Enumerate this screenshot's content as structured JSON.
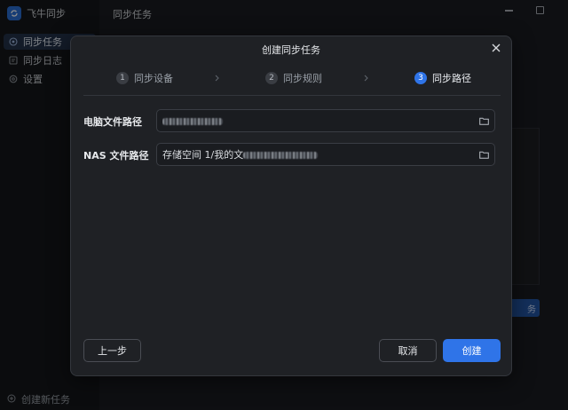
{
  "app": {
    "name": "飞牛同步",
    "main_title": "同步任务",
    "background_button_fragment": "务"
  },
  "sidebar": {
    "items": [
      {
        "label": "同步任务",
        "icon": "sync-icon",
        "active": true
      },
      {
        "label": "同步日志",
        "icon": "log-icon",
        "active": false
      },
      {
        "label": "设置",
        "icon": "settings-icon",
        "active": false
      }
    ],
    "new_task_label": "创建新任务"
  },
  "modal": {
    "title": "创建同步任务",
    "steps": [
      {
        "number": "1",
        "label": "同步设备",
        "active": false
      },
      {
        "number": "2",
        "label": "同步规则",
        "active": false
      },
      {
        "number": "3",
        "label": "同步路径",
        "active": true
      }
    ],
    "fields": {
      "pc_path": {
        "label": "电脑文件路径",
        "value": ""
      },
      "nas_path": {
        "label": "NAS 文件路径",
        "value_prefix": "存储空间 1/我的文"
      }
    },
    "buttons": {
      "prev": "上一步",
      "cancel": "取消",
      "create": "创建"
    }
  },
  "colors": {
    "accent": "#2f74e8",
    "modal_bg": "#1f2125",
    "page_bg": "#1b1d21"
  }
}
